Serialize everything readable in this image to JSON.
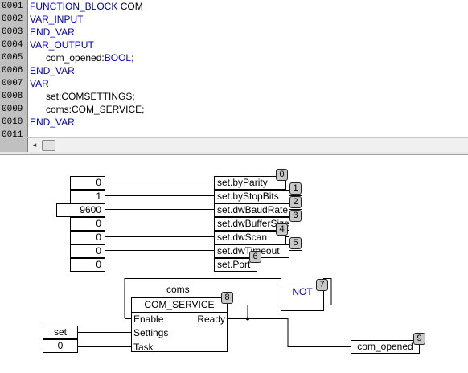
{
  "declaration": {
    "line_numbers": [
      "0001",
      "0002",
      "0003",
      "0004",
      "0005",
      "0006",
      "0007",
      "0008",
      "0009",
      "0010",
      "0011"
    ],
    "line1_keyword": "FUNCTION_BLOCK",
    "line1_name": "COM",
    "line2": "VAR_INPUT",
    "line3": "END_VAR",
    "line4": "VAR_OUTPUT",
    "line5_name": "com_opened:",
    "line5_type": "BOOL",
    "line5_end": ";",
    "line6": "END_VAR",
    "line7": "VAR",
    "line8": "set:COMSETTINGS;",
    "line9": "coms:COM_SERVICE;",
    "line10": "END_VAR"
  },
  "scrollbar": {
    "left_arrow": "◂"
  },
  "fbd": {
    "inputs": [
      "0",
      "1",
      "9600",
      "0",
      "0",
      "0",
      "0"
    ],
    "assignments": [
      "set.byParity",
      "set.byStopBits",
      "set.dwBaudRate",
      "set.dwBufferSize",
      "set.dwScan",
      "set.dwTimeout",
      "set.Port"
    ],
    "assignment_badges": [
      "0",
      "1",
      "2",
      "3",
      "4",
      "5",
      "6"
    ],
    "fb_instance": "coms",
    "fb_type": "COM_SERVICE",
    "fb_badge": "8",
    "fb_in_enable": "Enable",
    "fb_in_settings": "Settings",
    "fb_in_task": "Task",
    "fb_out_ready": "Ready",
    "settings_input": "set",
    "task_input": "0",
    "not_label": "NOT",
    "not_badge": "7",
    "output_name": "com_opened",
    "output_badge": "9"
  },
  "colors": {
    "keyword": "#0000c0",
    "gutter": "#c0c0c0"
  }
}
